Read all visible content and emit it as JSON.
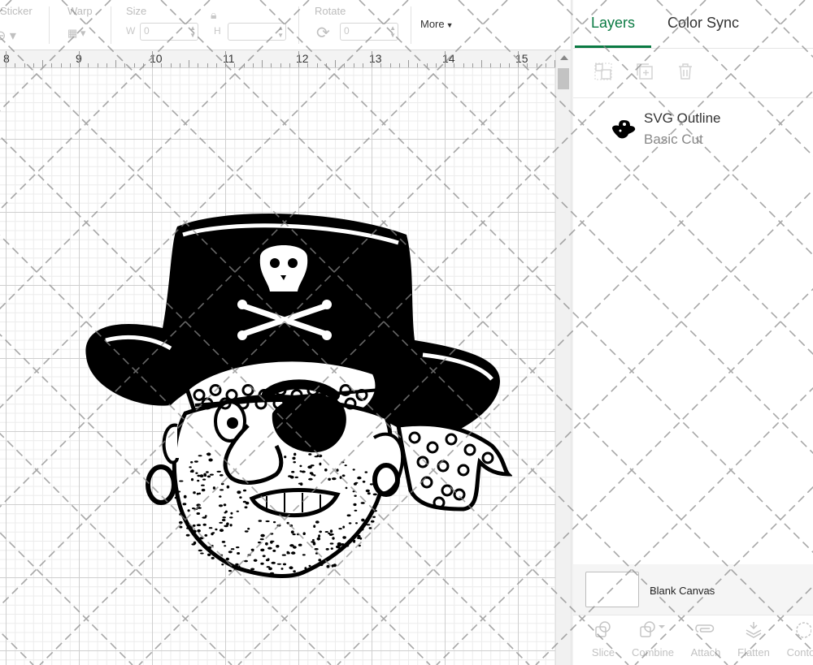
{
  "toolbar": {
    "sticker_label": "Sticker",
    "warp_label": "Warp",
    "size_label": "Size",
    "size_w_label": "W",
    "size_w_value": "0",
    "size_h_label": "H",
    "size_h_value": "",
    "rotate_label": "Rotate",
    "rotate_value": "0",
    "more_label": "More"
  },
  "ruler": {
    "numbers": [
      "8",
      "9",
      "10",
      "11",
      "12",
      "13",
      "14",
      "15"
    ]
  },
  "panel": {
    "tabs": [
      {
        "label": "Layers",
        "active": true
      },
      {
        "label": "Color Sync",
        "active": false
      }
    ],
    "layers": [
      {
        "name": "SVG Outline",
        "operation": "Basic Cut"
      }
    ],
    "canvas_label": "Blank Canvas",
    "bottom_tools": [
      {
        "label": "Slice",
        "icon": "slice-icon"
      },
      {
        "label": "Combine",
        "icon": "combine-icon"
      },
      {
        "label": "Attach",
        "icon": "attach-icon"
      },
      {
        "label": "Flatten",
        "icon": "flatten-icon"
      },
      {
        "label": "Conto",
        "icon": "contour-icon"
      }
    ]
  },
  "colors": {
    "accent": "#0a7a43",
    "artwork": "#000000"
  }
}
